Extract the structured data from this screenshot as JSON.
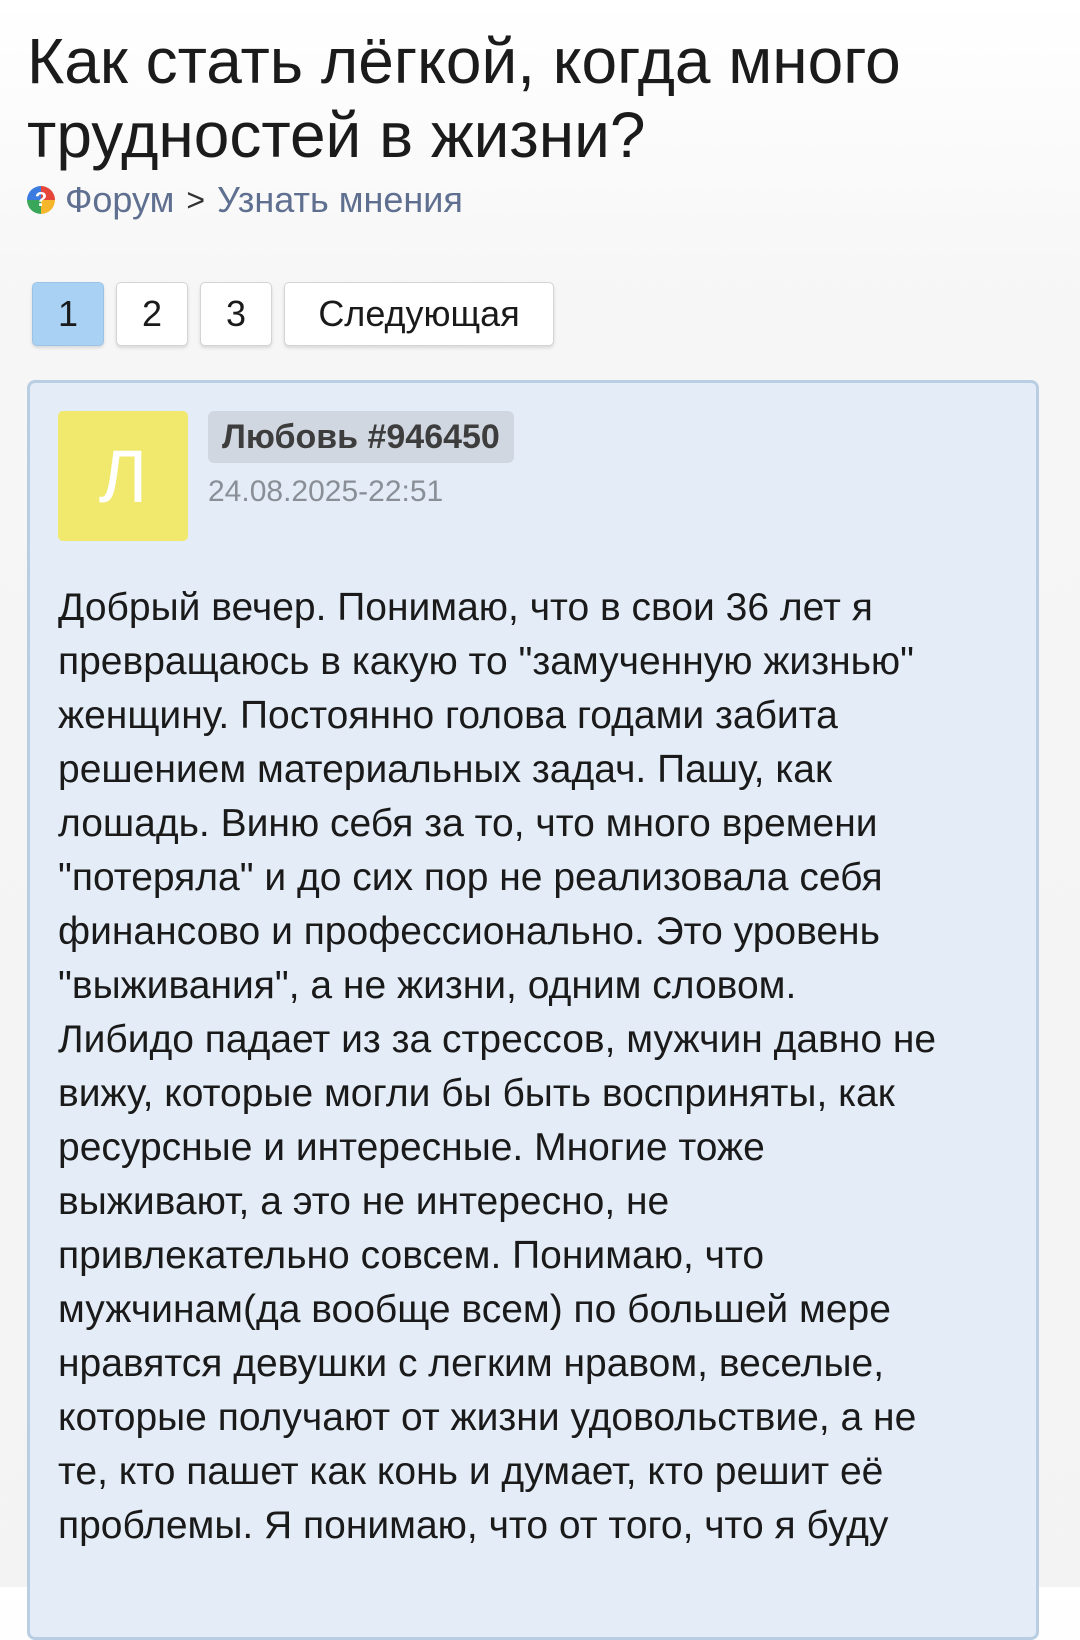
{
  "page": {
    "title": "Как стать лёгкой, когда много трудностей в жизни?"
  },
  "breadcrumb": {
    "icon": "forum-question-icon",
    "forum": "Форум",
    "separator": ">",
    "section": "Узнать мнения"
  },
  "pagination": {
    "pages": [
      "1",
      "2",
      "3"
    ],
    "active": "1",
    "next_label": "Следующая"
  },
  "post": {
    "avatar_letter": "Л",
    "avatar_color": "#f0e96d",
    "author": "Любовь #946450",
    "date": "24.08.2025-22:51",
    "lines": [
      "Добрый вечер. Понимаю, что в свои 36 лет я",
      "превращаюсь в какую то \"замученную жизнью\"",
      "женщину. Постоянно голова годами забита",
      "решением материальных задач. Пашу, как",
      "лошадь. Виню себя за то, что много времени",
      "\"потеряла\" и до сих пор не реализовала себя",
      "финансово и профессионально. Это уровень",
      "\"выживания\", а не жизни, одним словом.",
      "Либидо падает из за стрессов, мужчин давно не",
      "вижу, которые могли бы быть восприняты, как",
      "ресурсные и интересные. Многие тоже",
      "выживают, а это не интересно, не",
      "привлекательно совсем. Понимаю, что",
      "мужчинам(да вообще всем) по большей мере",
      "нравятся девушки с легким нравом, веселые,",
      "которые получают от жизни удовольствие, а не",
      "те, кто пашет как конь и думает, кто решит её",
      "проблемы. Я понимаю, что от того, что я буду"
    ]
  },
  "colors": {
    "active_page": "#a9d1f3",
    "post_background": "#e4edf7",
    "post_border": "#b9cee3",
    "link": "#5e6f8f"
  }
}
